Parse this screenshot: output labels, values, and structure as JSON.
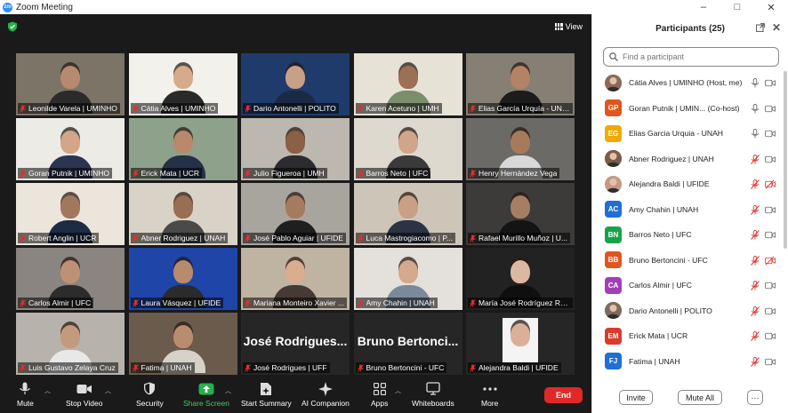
{
  "app": {
    "title": "Zoom Meeting",
    "icon_text": "zm"
  },
  "window_controls": [
    "–",
    "□",
    "✕"
  ],
  "view_button": {
    "label": "View"
  },
  "tiles": [
    {
      "name": "Leonilde Varela | UMINHO",
      "bg": "#7d7468",
      "skin": "#b58a6e",
      "shirt": "#2b2b2b"
    },
    {
      "name": "Cátia Alves | UMINHO",
      "bg": "#f3f1ec",
      "skin": "#d7aa8c",
      "shirt": "#2a2a2a",
      "active": true
    },
    {
      "name": "Dario Antonelli | POLITO",
      "bg": "#1f3b6b",
      "skin": "#c8a088",
      "shirt": "#1a2a44"
    },
    {
      "name": "Karen Acetuno | UMH",
      "bg": "#e6e2d6",
      "skin": "#9c7055",
      "shirt": "#7a8e6b"
    },
    {
      "name": "Elias García Urquía - UNAH",
      "bg": "#868074",
      "skin": "#b48264",
      "shirt": "#1c1c1c"
    },
    {
      "name": "Goran Putnik | UMINHO",
      "bg": "#ecebe6",
      "skin": "#d4a588",
      "shirt": "#2a3550"
    },
    {
      "name": "Erick Mata | UCR",
      "bg": "#8ea18a",
      "skin": "#b88a6b",
      "shirt": "#233046"
    },
    {
      "name": "Julio Figueroa | UMH",
      "bg": "#bcb8b0",
      "skin": "#8c6047",
      "shirt": "#2c2c30"
    },
    {
      "name": "Barros Neto | UFC",
      "bg": "#ddd9cf",
      "skin": "#d0a58a",
      "shirt": "#3a3a3a"
    },
    {
      "name": "Henry Hernández  Vega",
      "bg": "#6c6a66",
      "skin": "#a87a5c",
      "shirt": "#d8d8d8"
    },
    {
      "name": "Robert Anglin | UCR",
      "bg": "#ece5dc",
      "skin": "#a27760",
      "shirt": "#1e2b44"
    },
    {
      "name": "Abner Rodriguez | UNAH",
      "bg": "#d9d2c6",
      "skin": "#9a6e52",
      "shirt": "#4a4a4a"
    },
    {
      "name": "José Pablo Aguiar | UFIDE",
      "bg": "#a8a59f",
      "skin": "#a57b5f",
      "shirt": "#1f1f1f"
    },
    {
      "name": "Luca Mastrogiacomo | P...",
      "bg": "#ccc5b8",
      "skin": "#c9a086",
      "shirt": "#2b3344"
    },
    {
      "name": "Rafael Murillo Muñoz | U...",
      "bg": "#3d3b3a",
      "skin": "#a77e63",
      "shirt": "#141414"
    },
    {
      "name": "Carlos Almir | UFC",
      "bg": "#8a8580",
      "skin": "#be9177",
      "shirt": "#2c2c2c"
    },
    {
      "name": "Laura Vásquez | UFIDE",
      "bg": "#1f45a8",
      "skin": "#b88a6e",
      "shirt": "#2b2b2b"
    },
    {
      "name": "Mariana Monteiro Xavier ...",
      "bg": "#bfb3a2",
      "skin": "#d9ad8e",
      "shirt": "#463a34"
    },
    {
      "name": "Amy Chahin | UNAH",
      "bg": "#e4e1dc",
      "skin": "#d5a98c",
      "shirt": "#7b8a9a"
    },
    {
      "name": "María  José Rodríguez Ro...",
      "bg": "#222222",
      "skin": "#dcb8a2",
      "shirt": "#0f0f0f"
    },
    {
      "name": "Luis Gustavo Zelaya Cruz",
      "bg": "#b7b3ac",
      "skin": "#c49a7e",
      "shirt": "#e8e8e8"
    },
    {
      "name": "Fatima | UNAH",
      "bg": "#6b5b4c",
      "skin": "#b98c70",
      "shirt": "#d7d2c9"
    },
    {
      "name": "José Rodrigues | UFF",
      "bg": "#262626",
      "big": "José Rodrigues..."
    },
    {
      "name": "Bruno Bertoncini - UFC",
      "bg": "#262626",
      "big": "Bruno Bertonci..."
    },
    {
      "name": "Alejandra Baldi | UFIDE",
      "bg": "#262626",
      "skin": "#dcb097",
      "shirt": "#f4f4f4",
      "photo": true
    }
  ],
  "toolbar": [
    {
      "key": "mute",
      "label": "Mute"
    },
    {
      "key": "video",
      "label": "Stop Video"
    },
    {
      "key": "security",
      "label": "Security"
    },
    {
      "key": "share",
      "label": "Share Screen"
    },
    {
      "key": "summary",
      "label": "Start Summary"
    },
    {
      "key": "ai",
      "label": "AI Companion"
    },
    {
      "key": "apps",
      "label": "Apps"
    },
    {
      "key": "whiteboards",
      "label": "Whiteboards"
    },
    {
      "key": "more",
      "label": "More"
    }
  ],
  "end_button": {
    "label": "End"
  },
  "panel": {
    "title": "Participants (25)",
    "search_placeholder": "Find a participant",
    "participants": [
      {
        "label": "Cátia Alves | UMINHO (Host, me)",
        "avatar": "photo",
        "color": "#8a6a5a",
        "mic": "on",
        "video": "on"
      },
      {
        "label": "Goran Putnik | UMIN...  (Co-host)",
        "avatar": "GP",
        "color": "#e0561e",
        "mic": "on",
        "video": "on"
      },
      {
        "label": "Elias Garcia Urquia - UNAH",
        "avatar": "EG",
        "color": "#f2a900",
        "mic": "on",
        "video": "on"
      },
      {
        "label": "Abner Rodriguez | UNAH",
        "avatar": "photo",
        "color": "#7a5c4a",
        "mic": "off",
        "video": "on"
      },
      {
        "label": "Alejandra Baldi | UFIDE",
        "avatar": "photo",
        "color": "#c69a82",
        "mic": "off",
        "video": "off"
      },
      {
        "label": "Amy Chahin | UNAH",
        "avatar": "AC",
        "color": "#1f6fd6",
        "mic": "off",
        "video": "on"
      },
      {
        "label": "Barros Neto | UFC",
        "avatar": "BN",
        "color": "#17a34a",
        "mic": "off",
        "video": "on"
      },
      {
        "label": "Bruno Bertoncini - UFC",
        "avatar": "BB",
        "color": "#e0561e",
        "mic": "off",
        "video": "off"
      },
      {
        "label": "Carlos Almir | UFC",
        "avatar": "CA",
        "color": "#a23fb8",
        "mic": "off",
        "video": "on"
      },
      {
        "label": "Dario Antonelli | POLITO",
        "avatar": "photo",
        "color": "#7c6a60",
        "mic": "off",
        "video": "on"
      },
      {
        "label": "Erick Mata | UCR",
        "avatar": "EM",
        "color": "#d93c2c",
        "mic": "off",
        "video": "on"
      },
      {
        "label": "Fatima | UNAH",
        "avatar": "FJ",
        "color": "#1f6fd6",
        "mic": "off",
        "video": "on"
      }
    ],
    "invite_label": "Invite",
    "mute_all_label": "Mute All",
    "more_label": "···"
  }
}
